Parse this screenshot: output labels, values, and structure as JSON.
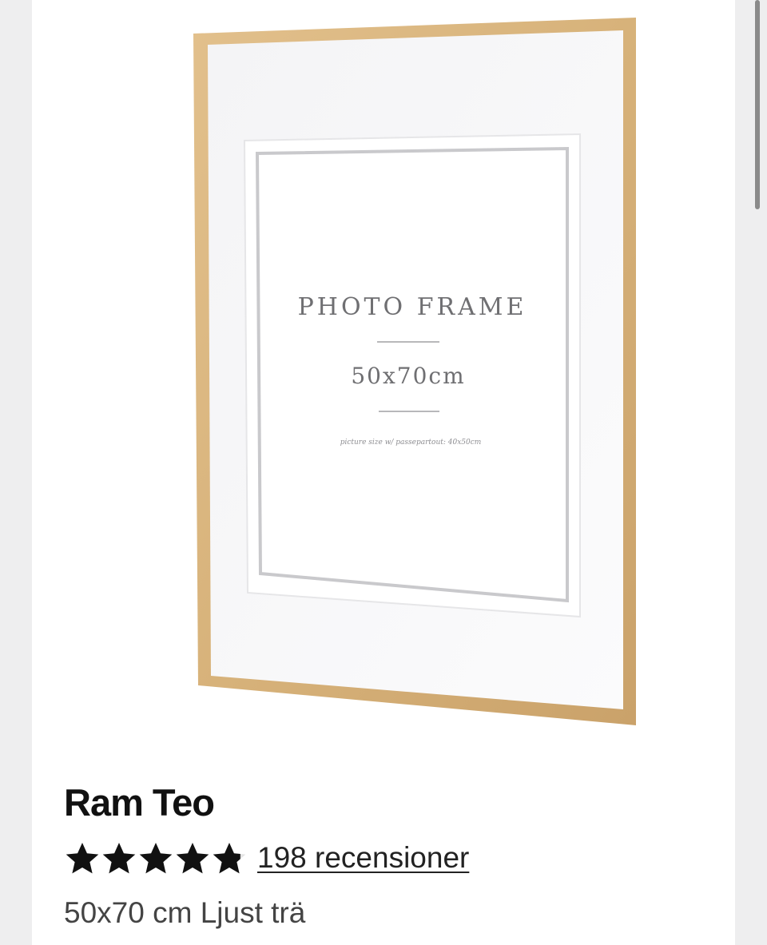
{
  "product": {
    "image": {
      "label_title": "PHOTO FRAME",
      "label_size": "50x70cm",
      "label_note": "picture size w/ passepartout: 40x50cm",
      "frame_color": "#d9b57f",
      "mat_color": "#ffffff"
    },
    "title": "Ram Teo",
    "rating": {
      "value": 4.8,
      "max": 5,
      "star_color": "#111111",
      "reviews_label": "198 recensioner"
    },
    "variant": "50x70 cm Ljust trä"
  }
}
